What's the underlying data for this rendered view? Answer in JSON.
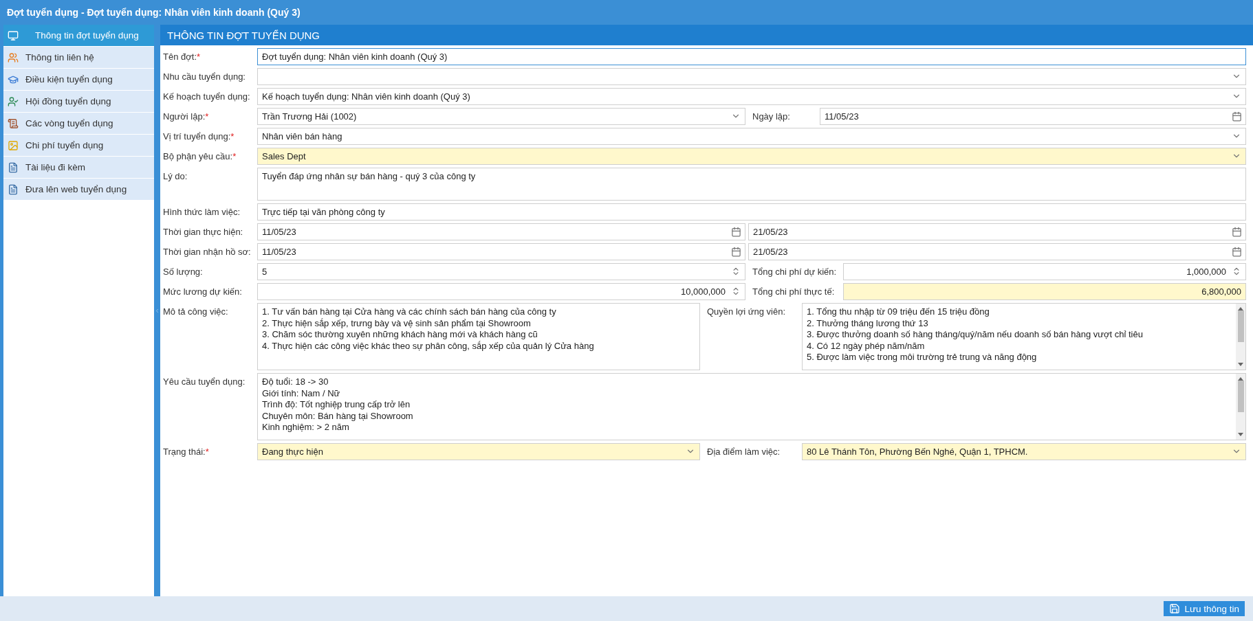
{
  "window": {
    "title": "Đợt tuyển dụng - Đợt tuyển dụng: Nhân viên kinh doanh (Quý 3)"
  },
  "sidebar": {
    "items": [
      {
        "label": "Thông tin đợt tuyển dụng",
        "selected": true
      },
      {
        "label": "Thông tin liên hệ",
        "selected": false
      },
      {
        "label": "Điều kiện tuyển dụng",
        "selected": false
      },
      {
        "label": "Hội đồng tuyển dụng",
        "selected": false
      },
      {
        "label": "Các vòng tuyển dụng",
        "selected": false
      },
      {
        "label": "Chi phí tuyển dụng",
        "selected": false
      },
      {
        "label": "Tài liệu đi kèm",
        "selected": false
      },
      {
        "label": "Đưa lên web tuyển dụng",
        "selected": false
      }
    ]
  },
  "section_title": "THÔNG TIN ĐỢT TUYỂN DỤNG",
  "form": {
    "rows": [
      {
        "kind": "single",
        "items": [
          {
            "label": "Tên đợt:",
            "required_mark": "*",
            "kind": "text",
            "value": "Đợt tuyển dụng: Nhân viên kinh doanh (Quý 3)",
            "highlighted": false,
            "focused": true
          }
        ]
      },
      {
        "kind": "single",
        "items": [
          {
            "label": "Nhu cầu tuyển dụng:",
            "kind": "select",
            "value": "",
            "highlighted": false,
            "focused": false
          }
        ]
      },
      {
        "kind": "single",
        "items": [
          {
            "label": "Kế hoạch tuyển dụng:",
            "kind": "select",
            "value": "Kế hoạch tuyển dụng: Nhân viên kinh doanh (Quý 3)",
            "highlighted": false,
            "focused": false
          }
        ]
      },
      {
        "kind": "pair",
        "items": [
          {
            "label": "Người lập:",
            "required_mark": "*",
            "kind": "select",
            "value": "Trần Trương Hải (1002)",
            "highlighted": false,
            "focused": false
          },
          {
            "label": "Ngày lập:",
            "kind": "date",
            "value": "11/05/23",
            "highlighted": false,
            "focused": false
          }
        ]
      },
      {
        "kind": "single",
        "items": [
          {
            "label": "Vị trí tuyển dụng:",
            "required_mark": "*",
            "kind": "select",
            "value": "Nhân viên bán hàng",
            "highlighted": false,
            "focused": false
          }
        ]
      },
      {
        "kind": "single",
        "items": [
          {
            "label": "Bộ phận yêu cầu:",
            "required_mark": "*",
            "kind": "select",
            "value": "Sales Dept",
            "highlighted": true,
            "focused": false
          }
        ]
      },
      {
        "kind": "single",
        "items": [
          {
            "label": "Lý do:",
            "kind": "textarea",
            "lines": [
              "Tuyển đáp ứng nhân sự bán hàng - quý 3 của công ty"
            ],
            "highlighted": false,
            "focused": false
          }
        ]
      },
      {
        "kind": "single",
        "items": [
          {
            "label": "Hình thức làm việc:",
            "kind": "text",
            "value": "Trực tiếp tại văn phòng công ty",
            "highlighted": false,
            "focused": false
          }
        ]
      },
      {
        "kind": "range",
        "items": [
          {
            "label": "Thời gian thực hiện:",
            "kind": "date",
            "value": "11/05/23",
            "highlighted": false,
            "focused": false
          },
          {
            "kind": "date",
            "value": "21/05/23",
            "highlighted": false,
            "focused": false
          }
        ]
      },
      {
        "kind": "range",
        "items": [
          {
            "label": "Thời gian nhận hồ sơ:",
            "kind": "date",
            "value": "11/05/23",
            "highlighted": false,
            "focused": false
          },
          {
            "kind": "date",
            "value": "21/05/23",
            "highlighted": false,
            "focused": false
          }
        ]
      },
      {
        "kind": "amount",
        "items": [
          {
            "label": "Số lượng:",
            "kind": "count",
            "value": "5",
            "highlighted": false,
            "focused": false
          },
          {
            "label": "Tổng chi phí dự kiến:",
            "kind": "number",
            "value": "1,000,000",
            "highlighted": false,
            "focused": false
          }
        ]
      },
      {
        "kind": "amount",
        "items": [
          {
            "label": "Mức lương dự kiến:",
            "kind": "number",
            "value": "10,000,000",
            "highlighted": false,
            "focused": false
          },
          {
            "label": "Tổng chi phí thực tế:",
            "kind": "amount",
            "value": "6,800,000",
            "highlighted": true,
            "focused": false
          }
        ]
      },
      {
        "kind": "split",
        "items": [
          {
            "label": "Mô tả công việc:",
            "kind": "textarea",
            "lines": [
              "1. Tư vấn bán hàng tại Cửa hàng và các chính sách bán hàng của công ty",
              "2. Thực hiện sắp xếp, trưng bày và vệ sinh sản phẩm tại Showroom",
              "3. Chăm sóc thường xuyên những khách hàng mới và khách hàng cũ",
              "4. Thực hiện các công việc khác theo sự phân công, sắp xếp của quản lý Cửa hàng"
            ],
            "highlighted": false,
            "focused": false
          },
          {
            "label": "Quyền lợi ứng viên:",
            "kind": "scroll-textarea",
            "lines": [
              "1. Tổng thu nhập từ 09 triệu đến 15 triệu đồng",
              "2. Thưởng tháng lương thứ 13",
              "3. Được thưởng doanh số hàng tháng/quý/năm nếu doanh số bán hàng vượt chỉ tiêu",
              "4. Có 12 ngày phép năm/năm",
              "5. Được làm việc trong môi trường trẻ trung và năng động"
            ],
            "highlighted": false,
            "focused": false
          }
        ]
      },
      {
        "kind": "single",
        "items": [
          {
            "label": "Yêu cầu tuyển dụng:",
            "kind": "scroll-textarea",
            "lines": [
              "Độ tuổi: 18 -> 30",
              "Giới tính: Nam / Nữ",
              "Trình độ: Tốt nghiệp trung cấp trở lên",
              "Chuyên môn: Bán hàng tại Showroom",
              "Kinh nghiệm: > 2 năm"
            ],
            "highlighted": false,
            "focused": false
          }
        ]
      },
      {
        "kind": "split",
        "items": [
          {
            "label": "Trạng thái:",
            "required_mark": "*",
            "kind": "select",
            "value": "Đang thực hiện",
            "highlighted": true,
            "focused": false
          },
          {
            "label": "Địa điểm làm việc:",
            "kind": "select",
            "value": "80 Lê Thánh Tôn, Phường Bến Nghé, Quận 1, TPHCM.",
            "highlighted": true,
            "focused": false
          }
        ]
      }
    ]
  },
  "save_button": "Lưu thông tin"
}
